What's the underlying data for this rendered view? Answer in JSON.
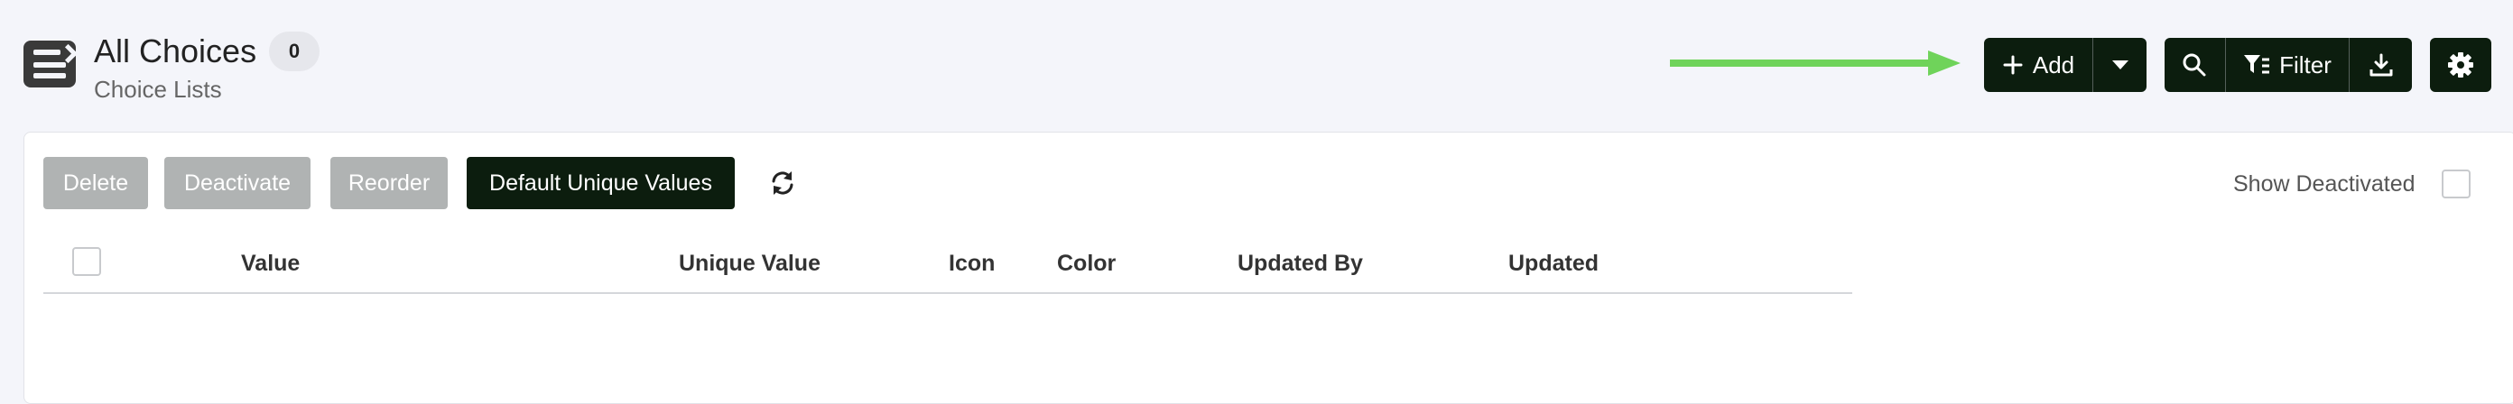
{
  "header": {
    "title": "All Choices",
    "count": "0",
    "subtitle": "Choice Lists"
  },
  "toolbar": {
    "add_label": "Add",
    "filter_label": "Filter"
  },
  "actions": {
    "delete_label": "Delete",
    "deactivate_label": "Deactivate",
    "reorder_label": "Reorder",
    "default_unique_label": "Default Unique Values",
    "show_deactivated_label": "Show Deactivated"
  },
  "table": {
    "columns": [
      "Value",
      "Unique Value",
      "Icon",
      "Color",
      "Updated By",
      "Updated"
    ]
  },
  "colors": {
    "primary": "#0c1d0e",
    "disabled": "#b0b3b3",
    "arrow": "#6fd35a",
    "background": "#f4f5fa"
  },
  "icons": [
    "list-icon",
    "plus-icon",
    "caret-down-icon",
    "search-icon",
    "filter-icon",
    "download-icon",
    "gear-icon",
    "refresh-icon",
    "arrow-icon"
  ]
}
